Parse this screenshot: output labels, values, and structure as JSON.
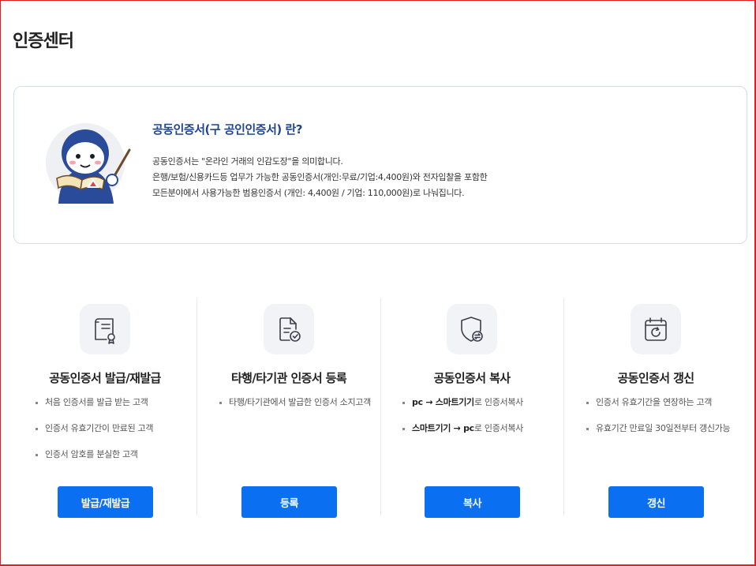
{
  "page": {
    "title": "인증센터"
  },
  "intro": {
    "heading": "공동인증서(구 공인인증서) 란?",
    "lines": [
      "공동인증서는 \"온라인 거래의 인감도장\"을 의미합니다.",
      "은행/보험/신용카드등 업무가 가능한 공동인증서(개인:무료/기업:4,400원)와 전자입찰을 포함한",
      "모든분야에서 사용가능한 범용인증서 (개인: 4,400원 / 기업: 110,000원)로 나눠집니다."
    ],
    "mascot_icon": "mascot-pointer-book"
  },
  "services": [
    {
      "icon": "certificate-document-icon",
      "title": "공동인증서 발급/재발급",
      "bullets": [
        "처음 인증서를 발급 받는 고객",
        "인증서 유효기간이 만료된 고객",
        "인증서 암호를 분실한 고객"
      ],
      "button": "발급/재발급"
    },
    {
      "icon": "document-check-icon",
      "title": "타행/타기관 인증서 등록",
      "bullets": [
        "타행/타기관에서 발급한 인증서 소지고객"
      ],
      "button": "등록"
    },
    {
      "icon": "shield-transfer-icon",
      "title": "공동인증서 복사",
      "bullets": [
        {
          "a": "pc → 스마트기기",
          "b": "로 인증서복사"
        },
        {
          "a": "스마트기기 → pc",
          "b": "로 인증서복사"
        }
      ],
      "button": "복사"
    },
    {
      "icon": "calendar-refresh-icon",
      "title": "공동인증서 갱신",
      "bullets": [
        "인증서 유효기간을 연장하는 고객",
        "유효기간 만료일 30일전부터 갱신가능"
      ],
      "button": "갱신"
    }
  ],
  "colors": {
    "accent": "#0a6ff0",
    "heading_blue": "#1f4592",
    "border": "#d5dfea",
    "frame": "#e0201e"
  }
}
